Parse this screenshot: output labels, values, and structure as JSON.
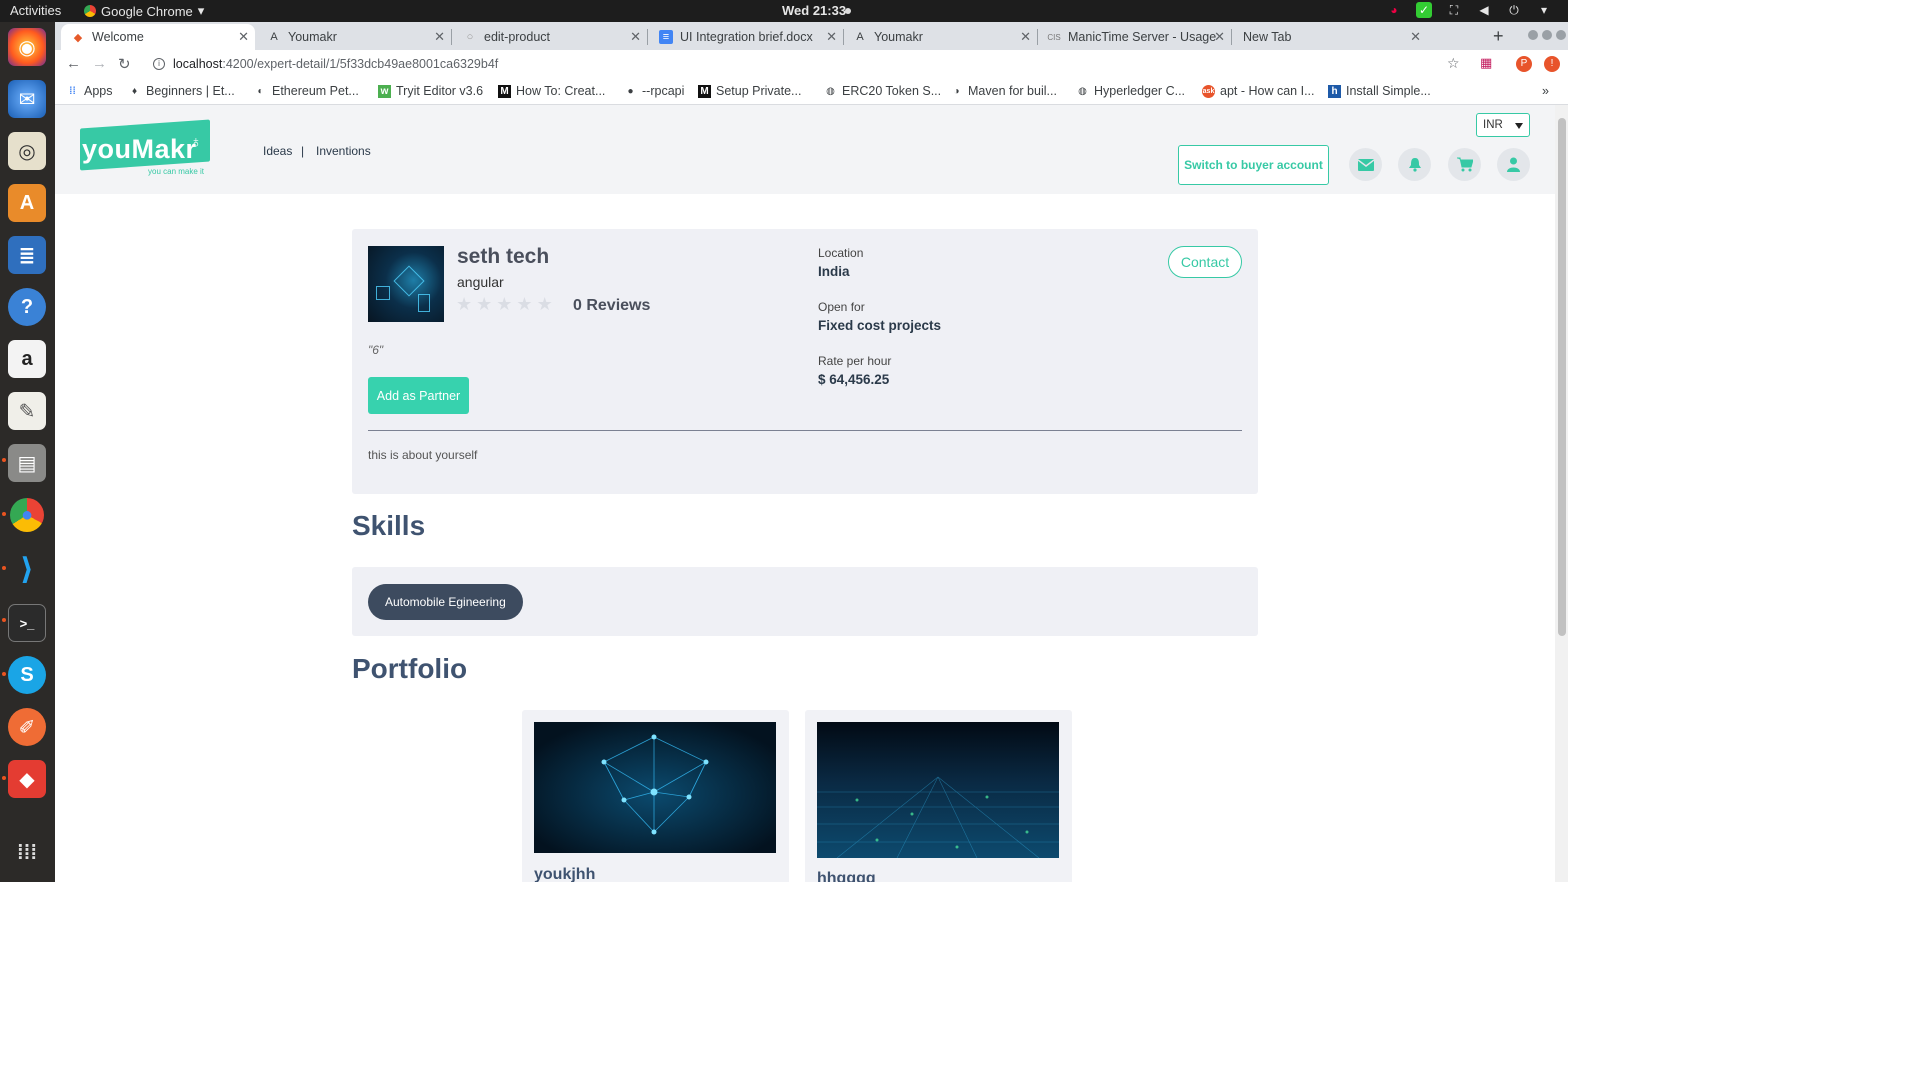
{
  "os": {
    "activities": "Activities",
    "app_name": "Google Chrome",
    "clock": "Wed 21:33"
  },
  "browser": {
    "tabs": [
      {
        "label": "Welcome"
      },
      {
        "label": "Youmakr"
      },
      {
        "label": "edit-product"
      },
      {
        "label": "UI Integration brief.docx"
      },
      {
        "label": "Youmakr"
      },
      {
        "label": "ManicTime Server - Usage"
      },
      {
        "label": "New Tab"
      }
    ],
    "url_host": "localhost",
    "url_path": ":4200/expert-detail/1/5f33dcb49ae8001ca6329b4f",
    "bookmarks": [
      "Apps",
      "Beginners | Et...",
      "Ethereum Pet...",
      "Tryit Editor v3.6",
      "How To: Creat...",
      "--rpcapi",
      "Setup Private...",
      "ERC20 Token S...",
      "Maven for buil...",
      "Hyperledger C...",
      "apt - How can I...",
      "Install Simple..."
    ]
  },
  "header": {
    "logo_text": "youMakr",
    "logo_tagline": "you can make it",
    "nav_ideas": "Ideas",
    "nav_sep": "|",
    "nav_inventions": "Inventions",
    "currency": "INR",
    "switch_label": "Switch to buyer account",
    "accent": "#37c9a5"
  },
  "profile": {
    "name": "seth tech",
    "skill": "angular",
    "rating": 0,
    "reviews": "0 Reviews",
    "quote": "\"6\"",
    "add_partner": "Add as Partner",
    "location_label": "Location",
    "location": "India",
    "open_for_label": "Open for",
    "open_for": "Fixed cost projects",
    "rate_label": "Rate per hour",
    "rate": "$ 64,456.25",
    "contact": "Contact",
    "about": "this is about yourself"
  },
  "skills": {
    "title": "Skills",
    "items": [
      "Automobile Egineering"
    ]
  },
  "portfolio": {
    "title": "Portfolio",
    "items": [
      {
        "title": "youkjhh"
      },
      {
        "title": "hhgggg"
      }
    ]
  }
}
